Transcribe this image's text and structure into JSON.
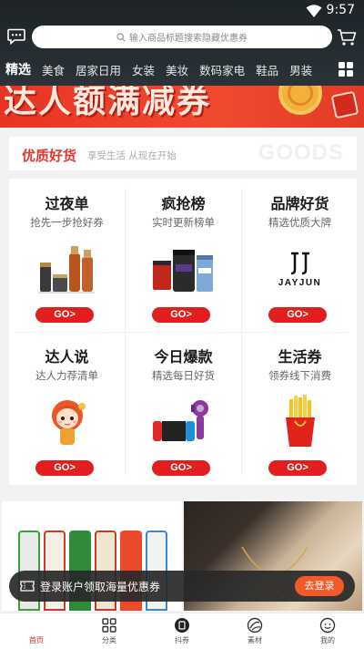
{
  "status_bar": {
    "time": "9:57"
  },
  "header": {
    "search_placeholder": "输入商品标题搜索隐藏优惠券",
    "categories": [
      "精选",
      "美食",
      "居家日用",
      "女装",
      "美妆",
      "数码家电",
      "鞋品",
      "男装"
    ],
    "active_category": "精选"
  },
  "banner": {
    "text": "达人额满减券"
  },
  "quality": {
    "title": "优质好货",
    "subtitle": "享受生活 从现在开始",
    "bg_text": "GOODS"
  },
  "cards": [
    {
      "title": "过夜单",
      "subtitle": "抢先一步抢好券",
      "button": "GO>",
      "image": "skincare-bottles"
    },
    {
      "title": "疯抢榜",
      "subtitle": "实时更新榜单",
      "button": "GO>",
      "image": "protein-tubs"
    },
    {
      "title": "品牌好货",
      "subtitle": "精选优质大牌",
      "button": "GO>",
      "image": "jayjun-logo",
      "brand": "JAYJUN"
    },
    {
      "title": "达人说",
      "subtitle": "达人力荐清单",
      "button": "GO>",
      "image": "girl-mascot"
    },
    {
      "title": "今日爆款",
      "subtitle": "精选每日好货",
      "button": "GO>",
      "image": "console-and-dryer"
    },
    {
      "title": "生活券",
      "subtitle": "领券线下消费",
      "button": "GO>",
      "image": "french-fries"
    }
  ],
  "toast": {
    "text": "登录账户领取海量优惠券",
    "button": "去登录"
  },
  "tabbar": [
    {
      "label": "首页",
      "icon": "home-icon",
      "active": true
    },
    {
      "label": "分类",
      "icon": "category-icon",
      "active": false
    },
    {
      "label": "抖券",
      "icon": "coupon-icon",
      "active": false
    },
    {
      "label": "素材",
      "icon": "material-icon",
      "active": false
    },
    {
      "label": "我的",
      "icon": "profile-icon",
      "active": false
    }
  ],
  "colors": {
    "brand_red": "#e21e1e",
    "header_dark": "#1d2327",
    "accent_orange": "#f15a2a"
  }
}
